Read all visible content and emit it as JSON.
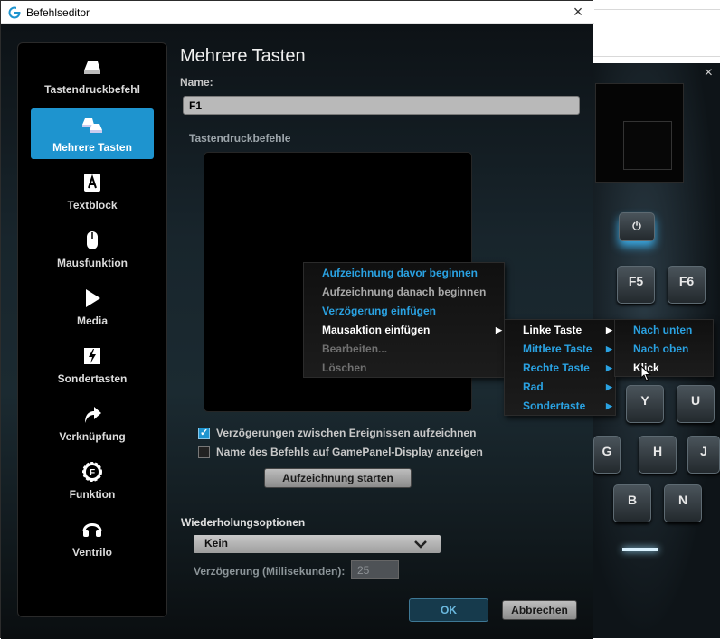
{
  "window": {
    "title": "Befehlseditor",
    "close": "×"
  },
  "sidebar": {
    "items": [
      {
        "label": "Tastendruckbefehl",
        "icon": "key-icon"
      },
      {
        "label": "Mehrere Tasten",
        "icon": "multi-keys-icon",
        "active": true
      },
      {
        "label": "Textblock",
        "icon": "text-block-icon"
      },
      {
        "label": "Mausfunktion",
        "icon": "mouse-icon"
      },
      {
        "label": "Media",
        "icon": "play-icon"
      },
      {
        "label": "Sondertasten",
        "icon": "special-key-icon"
      },
      {
        "label": "Verknüpfung",
        "icon": "shortcut-arrow-icon"
      },
      {
        "label": "Funktion",
        "icon": "function-gear-icon"
      },
      {
        "label": "Ventrilo",
        "icon": "headset-icon"
      }
    ]
  },
  "main": {
    "heading": "Mehrere Tasten",
    "name_label": "Name:",
    "name_value": "F1",
    "keystrokes_label": "Tastendruckbefehle",
    "record_delays_label": "Verzögerungen zwischen Ereignissen aufzeichnen",
    "record_delays_checked": true,
    "show_name_label": "Name des Befehls auf GamePanel-Display anzeigen",
    "show_name_checked": false,
    "start_recording_label": "Aufzeichnung starten",
    "repeat_label": "Wiederholungsoptionen",
    "repeat_value": "Kein",
    "delay_label": "Verzögerung (Millisekunden):",
    "delay_value": "25",
    "ok_label": "OK",
    "cancel_label": "Abbrechen"
  },
  "context_menu": {
    "items": [
      {
        "label": "Aufzeichnung davor beginnen",
        "state": "highlighted"
      },
      {
        "label": "Aufzeichnung danach beginnen",
        "state": "normal"
      },
      {
        "label": "Verzögerung einfügen",
        "state": "highlighted"
      },
      {
        "label": "Mausaktion einfügen",
        "state": "open"
      },
      {
        "label": "Bearbeiten...",
        "state": "disabled"
      },
      {
        "label": "Löschen",
        "state": "disabled"
      }
    ]
  },
  "mouse_submenu": {
    "items": [
      {
        "label": "Linke Taste",
        "state": "open"
      },
      {
        "label": "Mittlere Taste",
        "state": "highlighted"
      },
      {
        "label": "Rechte Taste",
        "state": "highlighted"
      },
      {
        "label": "Rad",
        "state": "highlighted"
      },
      {
        "label": "Sondertaste",
        "state": "highlighted"
      }
    ]
  },
  "button_submenu": {
    "items": [
      {
        "label": "Nach unten",
        "state": "highlighted"
      },
      {
        "label": "Nach oben",
        "state": "highlighted"
      },
      {
        "label": "Klick",
        "state": "hover"
      }
    ]
  },
  "keyboard_preview": {
    "close": "×",
    "keys": [
      "F5",
      "F6",
      "Y",
      "U",
      "G",
      "H",
      "J",
      "B",
      "N"
    ]
  },
  "colors": {
    "accent": "#1e94cf",
    "menu_highlight": "#2aa2e2"
  }
}
